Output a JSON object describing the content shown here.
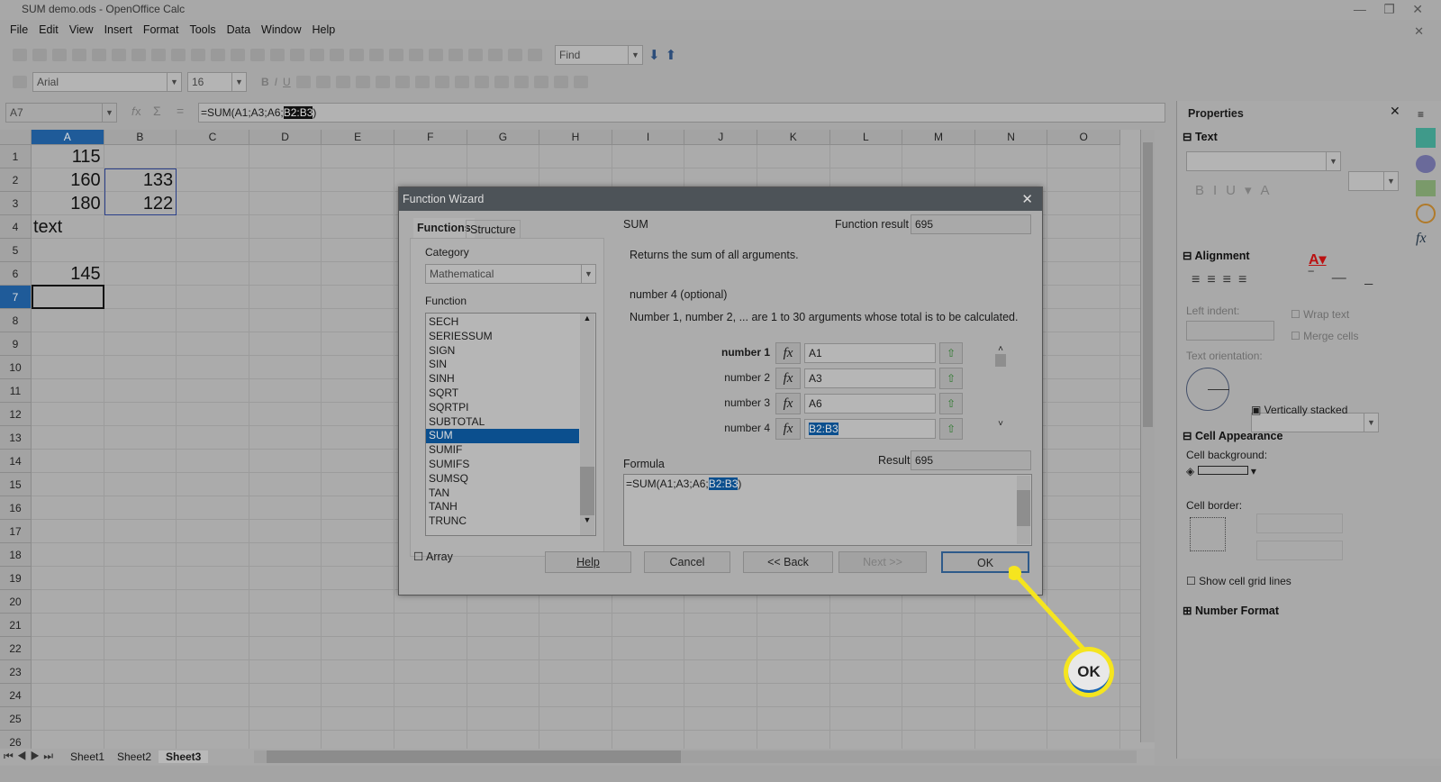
{
  "window": {
    "title": "SUM demo.ods - OpenOffice Calc"
  },
  "menu": [
    "File",
    "Edit",
    "View",
    "Insert",
    "Format",
    "Tools",
    "Data",
    "Window",
    "Help"
  ],
  "toolbar": {
    "find_placeholder": "Find",
    "font_name": "Arial",
    "font_size": "16"
  },
  "formula_bar": {
    "name_box": "A7",
    "formula_prefix": "=SUM(A1;A3;A6;",
    "formula_selected": "B2:B3",
    "formula_suffix": ")"
  },
  "columns": [
    "A",
    "B",
    "C",
    "D",
    "E",
    "F",
    "G",
    "H",
    "I",
    "J",
    "K",
    "L",
    "M",
    "N",
    "O"
  ],
  "rows": [
    "1",
    "2",
    "3",
    "4",
    "5",
    "6",
    "7",
    "8",
    "9",
    "10",
    "11",
    "12",
    "13",
    "14",
    "15",
    "16",
    "17",
    "18",
    "19",
    "20",
    "21",
    "22",
    "23",
    "24",
    "25",
    "26"
  ],
  "cells": {
    "A1": "115",
    "A2": "160",
    "A3": "180",
    "A4": "text",
    "A6": "145",
    "B2": "133",
    "B3": "122"
  },
  "sheet_tabs": [
    "Sheet1",
    "Sheet2",
    "Sheet3"
  ],
  "active_sheet": "Sheet3",
  "dialog": {
    "title": "Function Wizard",
    "tabs": [
      "Functions",
      "Structure"
    ],
    "category_label": "Category",
    "category_value": "Mathematical",
    "function_label": "Function",
    "functions": [
      "SECH",
      "SERIESSUM",
      "SIGN",
      "SIN",
      "SINH",
      "SQRT",
      "SQRTPI",
      "SUBTOTAL",
      "SUM",
      "SUMIF",
      "SUMIFS",
      "SUMSQ",
      "TAN",
      "TANH",
      "TRUNC"
    ],
    "selected_function": "SUM",
    "function_name": "SUM",
    "function_result_label": "Function result",
    "function_result": "695",
    "description": "Returns the sum of all arguments.",
    "arg_title": "number 4 (optional)",
    "arg_description": "Number 1, number 2, ... are 1 to 30 arguments whose total is to be calculated.",
    "args": [
      {
        "label": "number 1",
        "value": "A1"
      },
      {
        "label": "number 2",
        "value": "A3"
      },
      {
        "label": "number 3",
        "value": "A6"
      },
      {
        "label": "number 4",
        "value": "B2:B3"
      }
    ],
    "formula_label": "Formula",
    "result_label": "Result",
    "result": "695",
    "formula_prefix": "=SUM(A1;A3;A6;",
    "formula_selected": "B2:B3",
    "formula_suffix": ")",
    "array_label": "Array",
    "buttons": {
      "help": "Help",
      "cancel": "Cancel",
      "back": "<< Back",
      "next": "Next >>",
      "ok": "OK"
    }
  },
  "sidebar": {
    "title": "Properties",
    "text_section": "Text",
    "alignment_section": "Alignment",
    "left_indent": "Left indent:",
    "wrap_text": "Wrap text",
    "merge_cells": "Merge cells",
    "text_orientation": "Text orientation:",
    "vertically_stacked": "Vertically stacked",
    "cell_appearance_section": "Cell Appearance",
    "cell_background": "Cell background:",
    "cell_border": "Cell border:",
    "show_grid_lines": "Show cell grid lines",
    "number_format_section": "Number Format"
  },
  "callout": {
    "label": "OK",
    "color": "#f5e51f"
  }
}
